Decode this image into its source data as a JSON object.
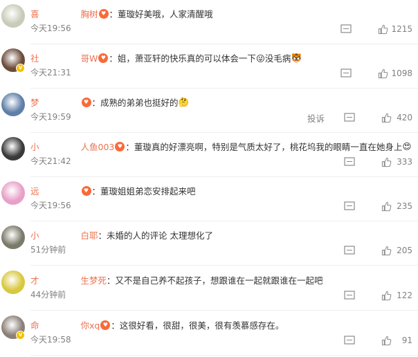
{
  "comments": [
    {
      "name_visible": "喜",
      "name_tail": "胸树",
      "text": "：董璇好美哦，人家清醒哦",
      "emoji": "",
      "time": "今天19:56",
      "report": "",
      "likes": "1215",
      "avatar_color": "#c8cbb8"
    },
    {
      "name_visible": "社",
      "name_tail": "哥W",
      "text": "：姐，萧亚轩的快乐真的可以体会一下",
      "emoji": "😜没毛病",
      "emoji_tail": "🐯",
      "time": "今天21:31",
      "report": "",
      "likes": "1098",
      "avatar_color": "#6b4b3a"
    },
    {
      "name_visible": "梦",
      "name_tail": "",
      "text": "：成熟的弟弟也挺好的",
      "emoji": "🤔",
      "time": "今天19:59",
      "report": "投诉",
      "likes": "420",
      "avatar_color": "#5f7fa8"
    },
    {
      "name_visible": "小",
      "name_tail": "人鱼003",
      "text": "：董璇真的好漂亮啊，特别是气质太好了，桃花坞我的眼睛一直在她身上",
      "emoji": "😍",
      "time": "今天21:42",
      "report": "",
      "likes": "333",
      "avatar_color": "#3a3a3a"
    },
    {
      "name_visible": "远",
      "name_tail": "",
      "text": "：董璇姐姐弟恋安排起来吧",
      "emoji": "",
      "time": "今天19:56",
      "report": "",
      "likes": "235",
      "avatar_color": "#e8a0c8"
    },
    {
      "name_visible": "小",
      "name_tail": "白耶",
      "text": "：未婚的人的评论 太理想化了",
      "emoji": "",
      "time": "51分钟前",
      "report": "",
      "likes": "205",
      "avatar_color": "#7a7a6a"
    },
    {
      "name_visible": "才",
      "name_tail": "生梦死",
      "text": "：又不是自己养不起孩子，想跟谁在一起就跟谁在一起吧",
      "emoji": "",
      "time": "44分钟前",
      "report": "",
      "likes": "122",
      "avatar_color": "#d8c840"
    },
    {
      "name_visible": "命",
      "name_tail": "你xq",
      "text": "：这很好看，很甜，很美，很有羡慕感存在。",
      "emoji": "",
      "time": "今天19:58",
      "report": "",
      "likes": "91",
      "avatar_color": "#8a8078"
    }
  ]
}
